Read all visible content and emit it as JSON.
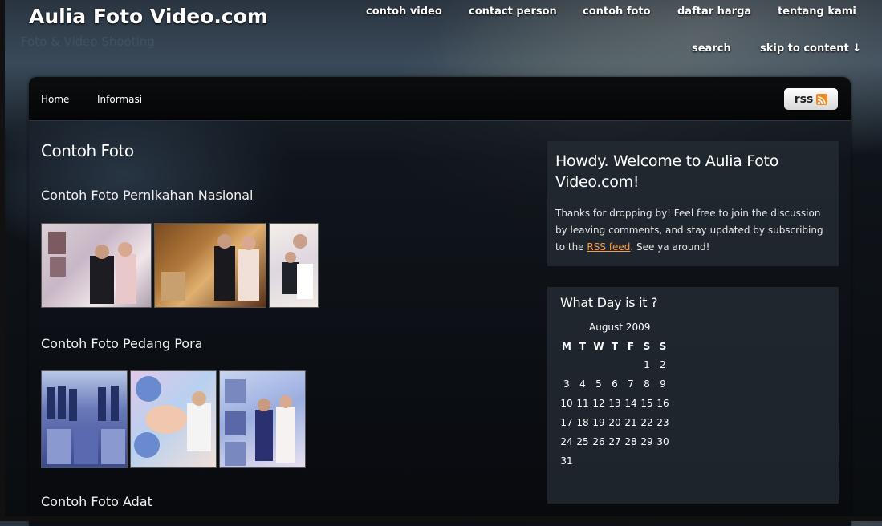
{
  "header": {
    "site_title": "Aulia Foto Video.com",
    "tagline": "Foto & Video Shooting",
    "nav": [
      "contoh video",
      "contact person",
      "contoh foto",
      "daftar harga",
      "tentang kami"
    ],
    "search_label": "search",
    "skip_label": "skip to content ↓"
  },
  "menubar": {
    "items": [
      "Home",
      "Informasi"
    ],
    "rss_label": "rss"
  },
  "main": {
    "page_title": "Contoh Foto",
    "sections": [
      {
        "title": "Contoh Foto Pernikahan Nasional"
      },
      {
        "title": "Contoh Foto Pedang Pora"
      },
      {
        "title": "Contoh Foto Adat"
      }
    ]
  },
  "sidebar": {
    "welcome": {
      "title": "Howdy. Welcome to Aulia Foto Video.com!",
      "text_before": "Thanks for dropping by! Feel free to join the discussion by leaving comments, and stay updated by subscribing to the ",
      "link": "RSS feed",
      "text_after": ". See ya around!"
    },
    "calendar": {
      "title": "What Day is it ?",
      "caption": "August 2009",
      "days": [
        "M",
        "T",
        "W",
        "T",
        "F",
        "S",
        "S"
      ],
      "weeks": [
        [
          "",
          "",
          "",
          "",
          "",
          "1",
          "2"
        ],
        [
          "3",
          "4",
          "5",
          "6",
          "7",
          "8",
          "9"
        ],
        [
          "10",
          "11",
          "12",
          "13",
          "14",
          "15",
          "16"
        ],
        [
          "17",
          "18",
          "19",
          "20",
          "21",
          "22",
          "23"
        ],
        [
          "24",
          "25",
          "26",
          "27",
          "28",
          "29",
          "30"
        ],
        [
          "31",
          "",
          "",
          "",
          "",
          "",
          ""
        ]
      ]
    }
  },
  "colors": {
    "accent_link": "#ff9a3c",
    "rss_orange": "#f08a24"
  }
}
